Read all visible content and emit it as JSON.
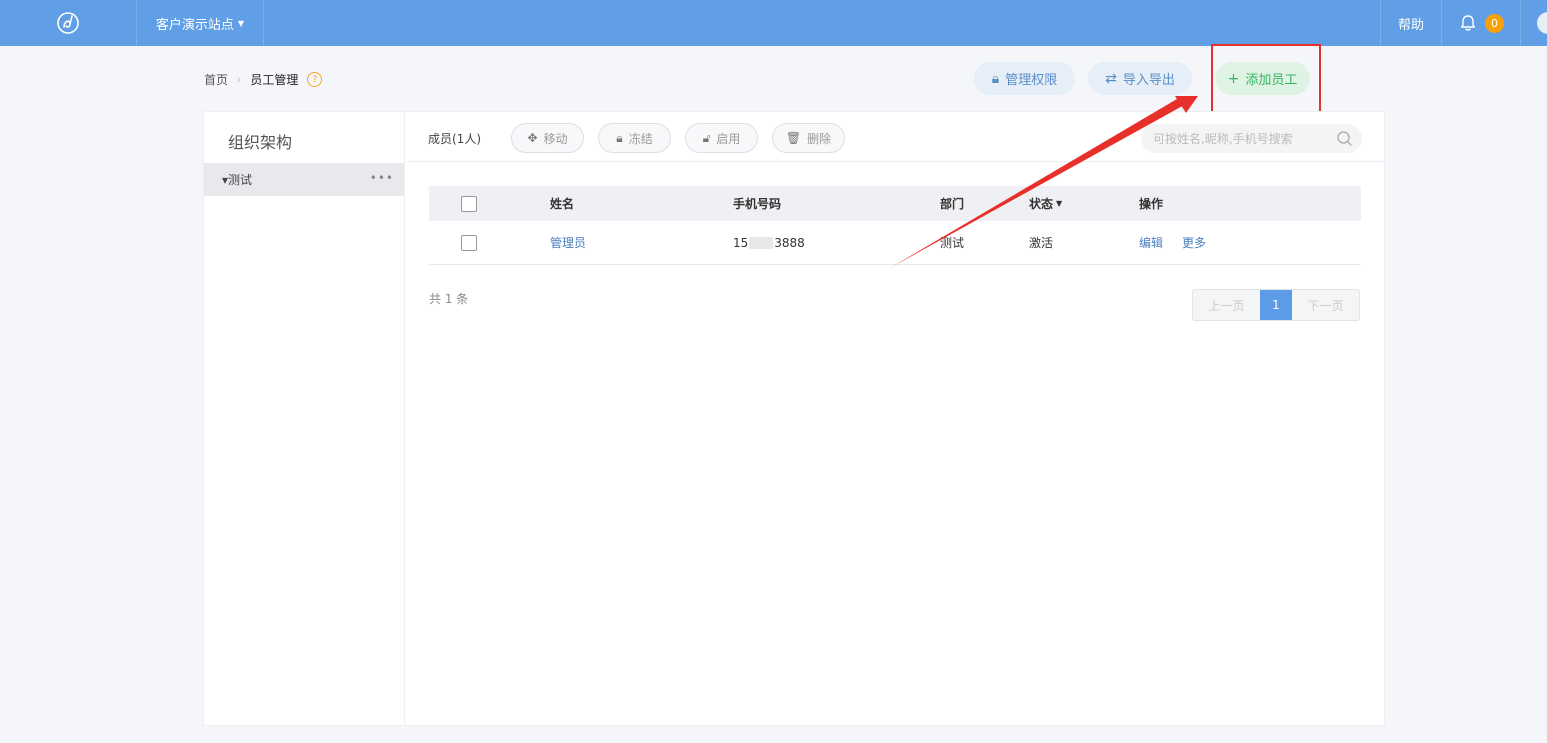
{
  "topbar": {
    "site_name": "客户演示站点",
    "help_label": "帮助",
    "notification_count": "0"
  },
  "breadcrumb": {
    "home": "首页",
    "current": "员工管理",
    "help_mark": "?"
  },
  "actions": {
    "permissions": "管理权限",
    "import_export": "导入导出",
    "add_employee": "添加员工"
  },
  "org": {
    "title": "组织架构",
    "items": [
      {
        "label": "▾测试"
      }
    ]
  },
  "toolbar": {
    "member_count": "成员(1人)",
    "move": "移动",
    "freeze": "冻结",
    "enable": "启用",
    "delete": "删除",
    "search_placeholder": "可按姓名,昵称,手机号搜索"
  },
  "table": {
    "columns": [
      "姓名",
      "手机号码",
      "部门",
      "状态",
      "操作"
    ],
    "rows": [
      {
        "name": "管理员",
        "phone_prefix": "15",
        "phone_suffix": "3888",
        "department": "测试",
        "status": "激活",
        "edit": "编辑",
        "more": "更多"
      }
    ]
  },
  "footer": {
    "total": "共 1 条",
    "prev": "上一页",
    "current_page": "1",
    "next": "下一页"
  },
  "colors": {
    "topbar": "#609fe6",
    "accent_green": "#34b460",
    "link": "#4a7fc1",
    "annotation_red": "#e8302a",
    "badge": "#f5a10b"
  }
}
